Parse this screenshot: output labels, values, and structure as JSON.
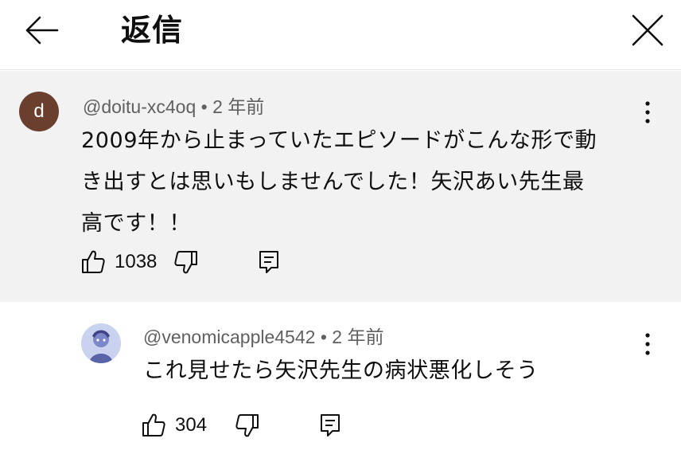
{
  "header": {
    "title": "返信"
  },
  "parent_comment": {
    "avatar_letter": "d",
    "avatar_color": "#6b3f2e",
    "author": "@doitu-xc4oq",
    "separator": "•",
    "time": "2 年前",
    "text_lines": [
      "2009年から止まっていたエピソードがこんな形で動",
      "き出すとは思いもしませんでした！矢沢あい先生最",
      "高です！！"
    ],
    "likes": "1038"
  },
  "reply_comment": {
    "author": "@venomicapple4542",
    "separator": "•",
    "time": "2 年前",
    "text": "これ見せたら矢沢先生の病状悪化しそう",
    "likes": "304"
  },
  "colors": {
    "parent_background": "#f2f2f2",
    "meta_text": "#606060",
    "body_text": "#0f0f0f"
  },
  "icons": [
    "back-arrow-icon",
    "close-icon",
    "more-vert-icon",
    "thumbs-up-icon",
    "thumbs-down-icon",
    "reply-icon"
  ]
}
